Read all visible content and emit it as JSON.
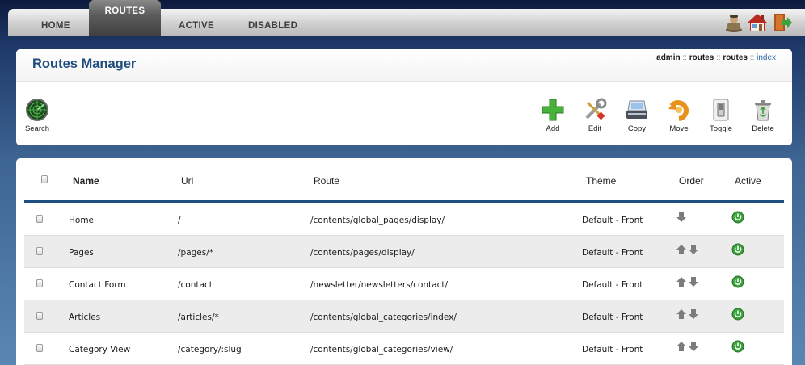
{
  "nav": {
    "tabs": [
      "HOME",
      "ROUTES",
      "ACTIVE",
      "DISABLED"
    ],
    "active_tab": "ROUTES",
    "icons": [
      "users-icon",
      "home-icon",
      "logout-icon"
    ]
  },
  "header": {
    "title": "Routes Manager",
    "breadcrumb": [
      "admin",
      "routes",
      "routes",
      "index"
    ],
    "breadcrumb_sep": "::"
  },
  "toolbar": {
    "search_label": "Search",
    "add_label": "Add",
    "edit_label": "Edit",
    "copy_label": "Copy",
    "move_label": "Move",
    "toggle_label": "Toggle",
    "delete_label": "Delete"
  },
  "table": {
    "columns": {
      "name": "Name",
      "url": "Url",
      "route": "Route",
      "theme": "Theme",
      "order": "Order",
      "active": "Active"
    },
    "rows": [
      {
        "name": "Home",
        "url": "/",
        "route": "/contents/global_pages/display/",
        "theme": "Default - Front",
        "order": "down",
        "active": true
      },
      {
        "name": "Pages",
        "url": "/pages/*",
        "route": "/contents/pages/display/",
        "theme": "Default - Front",
        "order": "up-down",
        "active": true
      },
      {
        "name": "Contact Form",
        "url": "/contact",
        "route": "/newsletter/newsletters/contact/",
        "theme": "Default - Front",
        "order": "up-down",
        "active": true
      },
      {
        "name": "Articles",
        "url": "/articles/*",
        "route": "/contents/global_categories/index/",
        "theme": "Default - Front",
        "order": "up-down",
        "active": true
      },
      {
        "name": "Category View",
        "url": "/category/:slug",
        "route": "/contents/global_categories/view/",
        "theme": "Default - Front",
        "order": "up-down",
        "active": true
      }
    ]
  },
  "colors": {
    "title": "#1d4c7c",
    "header_line": "#1c4f80",
    "active_green": "#3aa23a",
    "row_alt": "#ececec"
  }
}
